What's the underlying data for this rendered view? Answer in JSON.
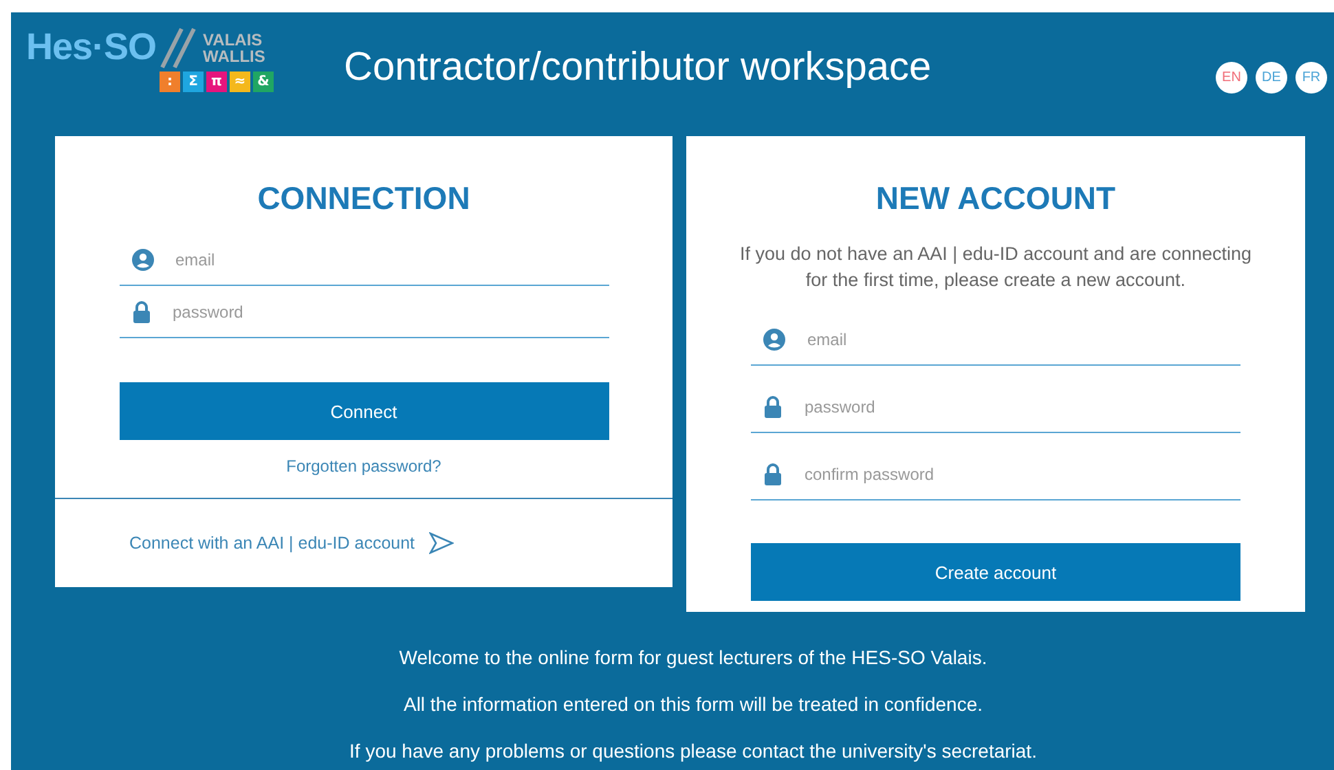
{
  "logo": {
    "brand": "Hes·SO",
    "region": [
      "VALAIS",
      "WALLIS"
    ],
    "tiles": [
      {
        "symbol": ":",
        "color": "#f07f2c"
      },
      {
        "symbol": "Σ",
        "color": "#1fa6e0"
      },
      {
        "symbol": "π",
        "color": "#e6147d"
      },
      {
        "symbol": "≈",
        "color": "#f4b81c"
      },
      {
        "symbol": "&",
        "color": "#20a663"
      }
    ]
  },
  "title": "Contractor/contributor workspace",
  "languages": [
    {
      "label": "EN",
      "selected": true
    },
    {
      "label": "DE",
      "selected": false
    },
    {
      "label": "FR",
      "selected": false
    }
  ],
  "connection": {
    "title": "CONNECTION",
    "fields": [
      {
        "kind": "user",
        "placeholder": "email"
      },
      {
        "kind": "lock",
        "placeholder": "password"
      }
    ],
    "button": "Connect",
    "forgot_link": "Forgotten password?",
    "aai_link": "Connect with an AAI | edu-ID account"
  },
  "new_account": {
    "title": "NEW ACCOUNT",
    "description": "If you do not have an AAI | edu-ID account and are connecting for the first time, please create a new account.",
    "fields": [
      {
        "kind": "user",
        "placeholder": "email"
      },
      {
        "kind": "lock",
        "placeholder": "password"
      },
      {
        "kind": "lock",
        "placeholder": "confirm password"
      }
    ],
    "button": "Create account"
  },
  "footer": [
    "Welcome to the online form for guest lecturers of the HES-SO Valais.",
    "All the information entered on this form will be treated in confidence.",
    "If you have any problems or questions please contact the university's secretariat."
  ]
}
